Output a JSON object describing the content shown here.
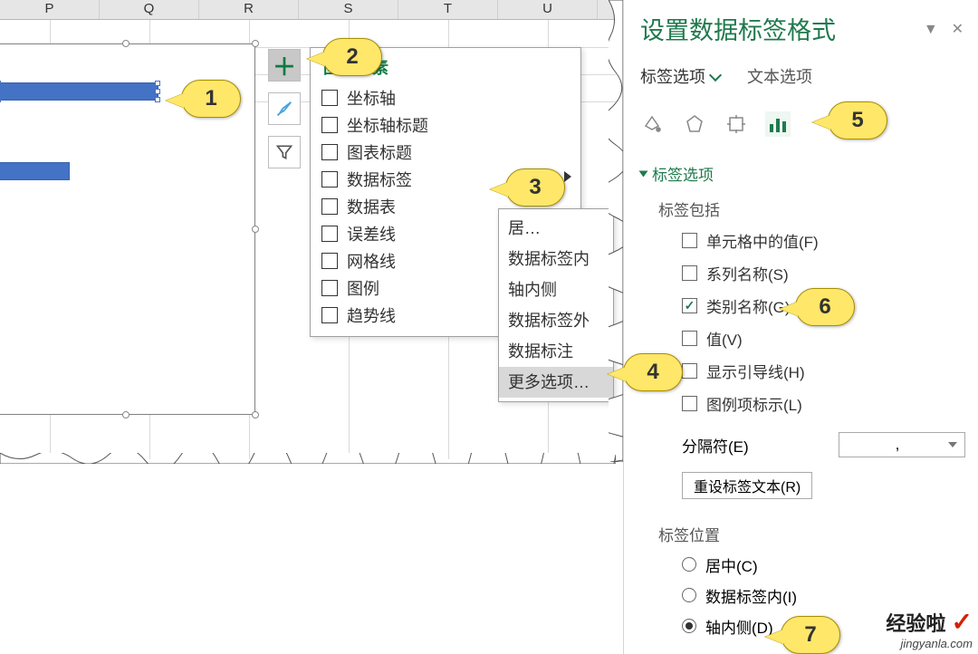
{
  "cols": [
    "P",
    "Q",
    "R",
    "S",
    "T",
    "U"
  ],
  "sidebtn": {
    "plus": "+"
  },
  "flyout": {
    "title": "图表元素",
    "items": [
      "坐标轴",
      "坐标轴标题",
      "图表标题",
      "数据标签",
      "数据表",
      "误差线",
      "网格线",
      "图例",
      "趋势线"
    ]
  },
  "submenu": {
    "items": [
      "居…",
      "数据标签内",
      "轴内侧",
      "数据标签外",
      "数据标注",
      "更多选项…"
    ]
  },
  "panel": {
    "title": "设置数据标签格式",
    "tab_active": "标签选项",
    "tab_other": "文本选项",
    "section_title": "标签选项",
    "labels_include": "标签包括",
    "chk": {
      "cell_val": "单元格中的值(F)",
      "series": "系列名称(S)",
      "category": "类别名称(G)",
      "value": "值(V)",
      "leader": "显示引导线(H)",
      "legend": "图例项标示(L)"
    },
    "sep_label": "分隔符(E)",
    "sep_val": ",",
    "reset_btn": "重设标签文本(R)",
    "pos_label": "标签位置",
    "pos": {
      "center": "居中(C)",
      "inside_end": "数据标签内(I)",
      "inside_base": "轴内侧(D)"
    }
  },
  "callouts": {
    "c1": "1",
    "c2": "2",
    "c3": "3",
    "c4": "4",
    "c5": "5",
    "c6": "6",
    "c7": "7"
  },
  "watermark": {
    "t1": "经验啦",
    "t2": "jingyanla.com",
    "ck": "✓"
  }
}
